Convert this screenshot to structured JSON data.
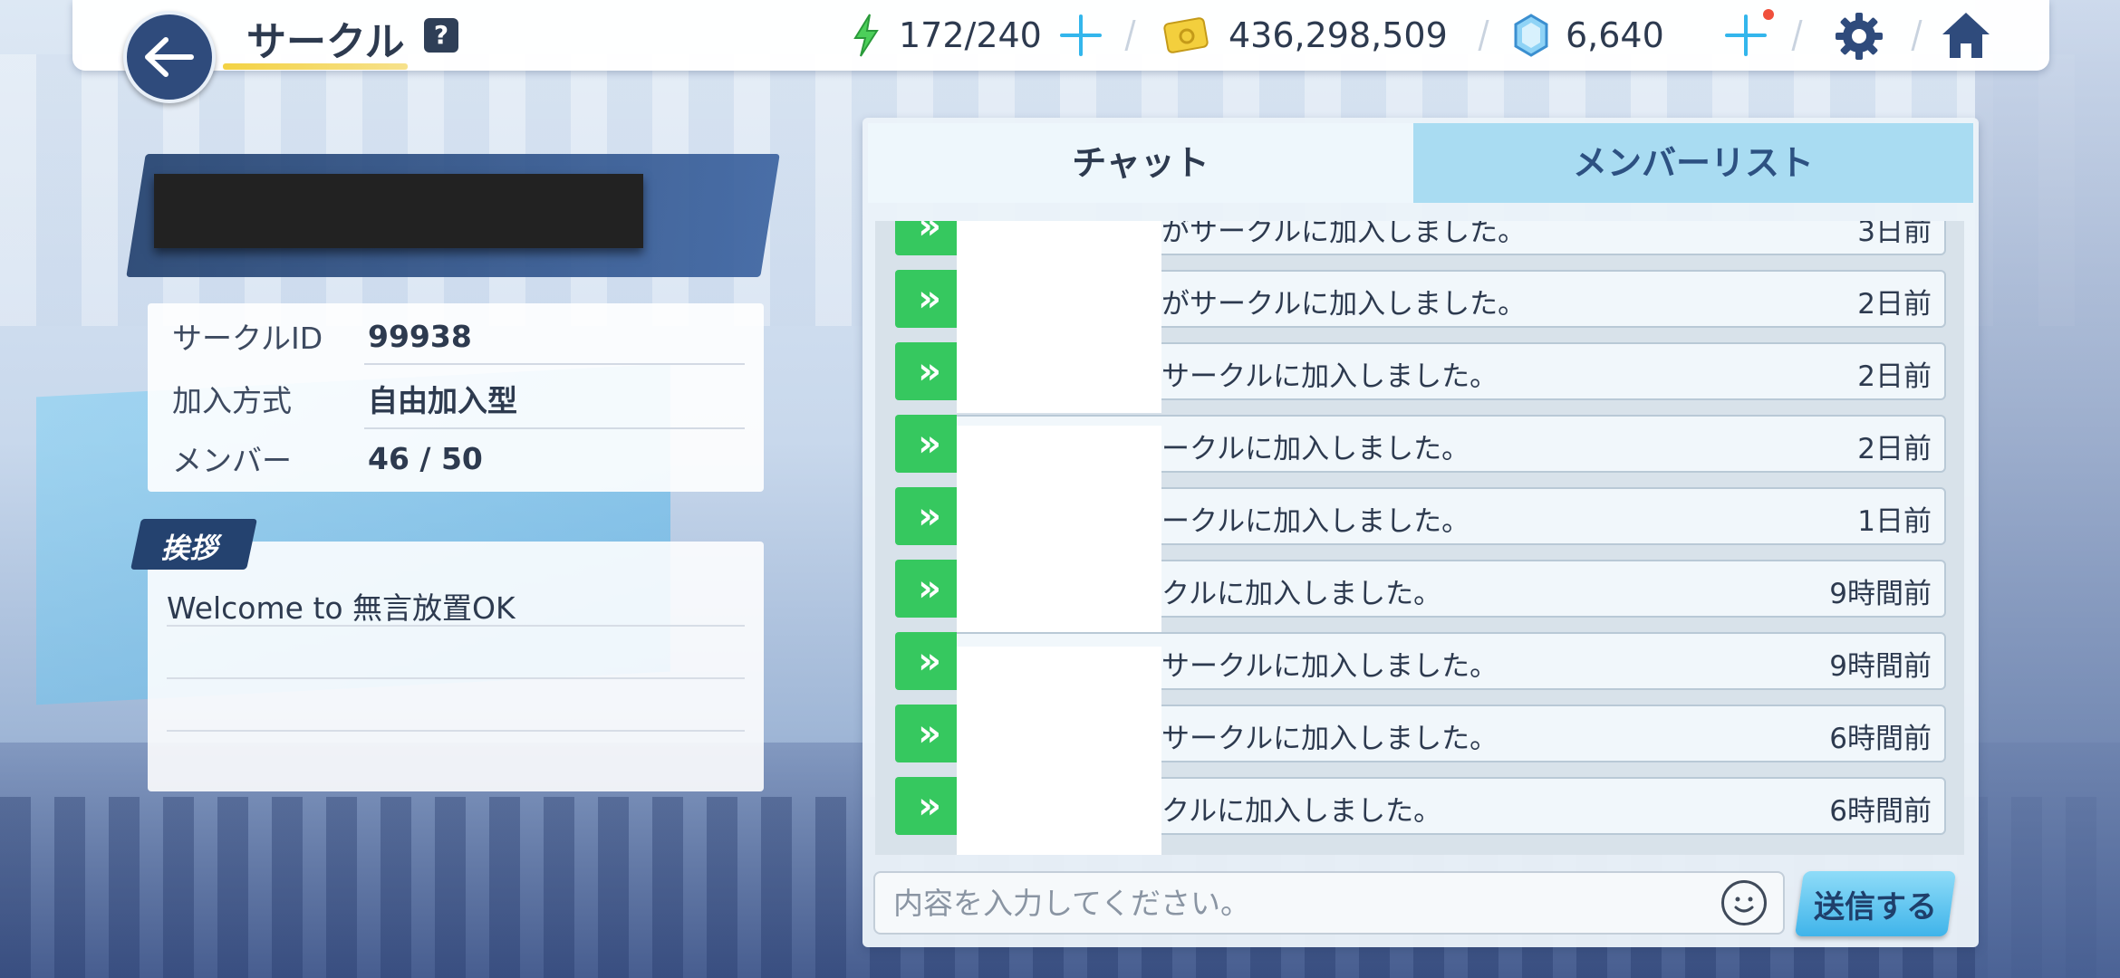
{
  "header": {
    "title": "サークル",
    "help_label": "?",
    "stamina": "172/240",
    "credits": "436,298,509",
    "gems": "6,640"
  },
  "circle": {
    "id_label": "サークルID",
    "id_value": "99938",
    "join_label": "加入方式",
    "join_value": "自由加入型",
    "members_label": "メンバー",
    "members_value": "46 / 50",
    "greeting_tab": "挨拶",
    "greeting_text": "Welcome to 無言放置OK"
  },
  "tabs": {
    "chat": "チャット",
    "members": "メンバーリスト"
  },
  "chat": {
    "messages": [
      {
        "text": "がサークルに加入しました。",
        "time": "3日前"
      },
      {
        "text": "がサークルに加入しました。",
        "time": "2日前"
      },
      {
        "text": "サークルに加入しました。",
        "time": "2日前"
      },
      {
        "text": "ークルに加入しました。",
        "time": "2日前"
      },
      {
        "text": "ークルに加入しました。",
        "time": "1日前"
      },
      {
        "text": "クルに加入しました。",
        "time": "9時間前"
      },
      {
        "text": "サークルに加入しました。",
        "time": "9時間前"
      },
      {
        "text": "サークルに加入しました。",
        "time": "6時間前"
      },
      {
        "text": "クルに加入しました。",
        "time": "6時間前"
      }
    ],
    "input_placeholder": "内容を入力してください。",
    "send_label": "送信する"
  },
  "colors": {
    "accent": "#33b6ec",
    "navy": "#24426f",
    "green_icon": "#36c85f",
    "tab_inactive": "#a9dcf2"
  },
  "icons": [
    "back-arrow-icon",
    "lightning-icon",
    "credit-card-icon",
    "gem-icon",
    "gear-icon",
    "home-icon",
    "smiley-icon",
    "chevron-double-right-icon"
  ]
}
